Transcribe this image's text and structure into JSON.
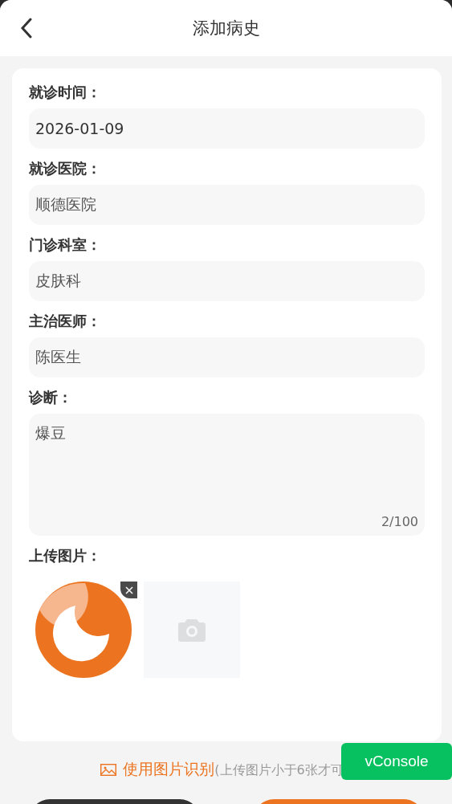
{
  "header": {
    "title": "添加病史"
  },
  "form": {
    "fields": [
      {
        "kind": "date",
        "label": "就诊时间：",
        "value": "2026-01-09"
      },
      {
        "kind": "text",
        "label": "就诊医院：",
        "value": "顺德医院"
      },
      {
        "kind": "text",
        "label": "门诊科室：",
        "value": "皮肤科"
      },
      {
        "kind": "text",
        "label": "主治医师：",
        "value": "陈医生"
      },
      {
        "kind": "textarea",
        "label": "诊断：",
        "value": "爆豆",
        "counter": "2/100"
      }
    ],
    "upload": {
      "label": "上传图片："
    }
  },
  "hint": {
    "link": "使用图片识别",
    "note": "(上传图片小于6张才可"
  },
  "vconsole": "vConsole"
}
